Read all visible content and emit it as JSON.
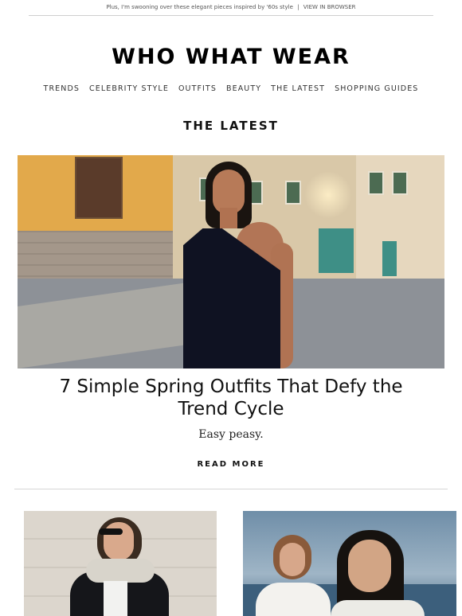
{
  "preheader": {
    "text": "Plus, I'm swooning over these elegant pieces inspired by '60s style",
    "separator": "|",
    "view_in_browser": "VIEW IN BROWSER"
  },
  "brand": {
    "logo_text": "WHO WHAT WEAR"
  },
  "nav": {
    "items": [
      "TRENDS",
      "CELEBRITY STYLE",
      "OUTFITS",
      "BEAUTY",
      "THE LATEST",
      "SHOPPING GUIDES"
    ]
  },
  "section": {
    "title": "THE LATEST"
  },
  "feature": {
    "headline": "7 Simple Spring Outfits That Defy the Trend Cycle",
    "dek": "Easy peasy.",
    "cta": "READ MORE"
  },
  "colors": {
    "text": "#111111",
    "rule": "#d6d6d6",
    "background": "#ffffff"
  }
}
